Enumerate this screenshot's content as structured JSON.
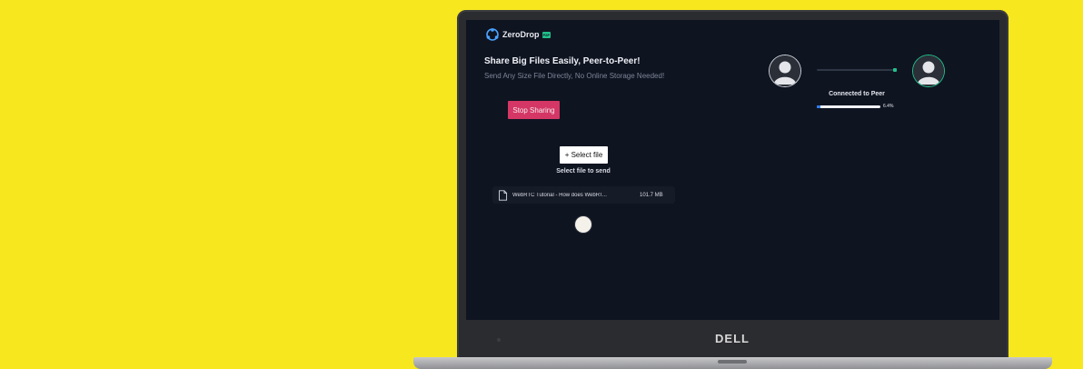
{
  "device": {
    "brand": "DELL"
  },
  "app": {
    "name": "ZeroDrop",
    "badge": "P2P",
    "headline": "Share Big Files Easily, Peer-to-Peer!",
    "subheadline": "Send Any Size File Directly, No Online Storage Needed!",
    "stop_button": "Stop Sharing",
    "select_button": "+ Select file",
    "select_hint": "Select file to send"
  },
  "file": {
    "name": "WebRTC Tutorial - How does WebRT...",
    "size": "101.7 MB"
  },
  "connection": {
    "status": "Connected to Peer",
    "progress_label": "6.4%",
    "progress_fraction": 0.064
  },
  "colors": {
    "background": "#f7e71e",
    "screen": "#0f1421",
    "stop_button": "#d43765",
    "accent_green": "#22c08a",
    "progress_blue": "#2f7df5"
  },
  "icons": [
    "app-logo-icon",
    "file-icon",
    "user-avatar-icon"
  ]
}
